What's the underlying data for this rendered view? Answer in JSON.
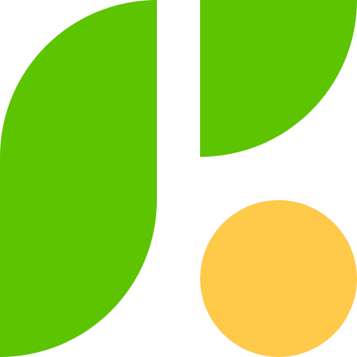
{
  "logo": {
    "icon": "leaf-logo-icon",
    "colors": {
      "background": "#ffffff",
      "leaf": "#5cc400",
      "dot": "#ffc94a"
    }
  }
}
